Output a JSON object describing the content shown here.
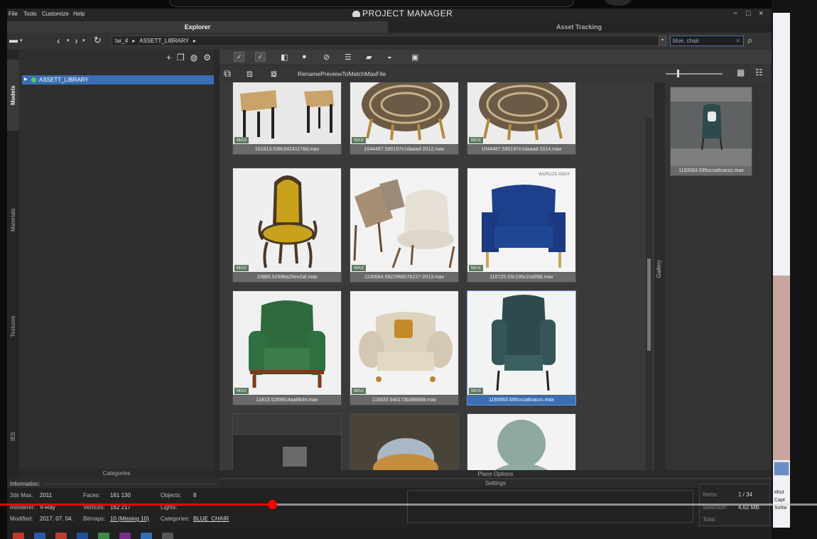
{
  "menu": {
    "file": "File",
    "tools": "Tools",
    "customize": "Customize",
    "help": "Help"
  },
  "app_title": "PROJECT MANAGER",
  "window_controls": {
    "minimize": "−",
    "maximize": "□",
    "close": "×"
  },
  "tabs": {
    "explorer": "Explorer",
    "asset_tracking": "Asset Tracking"
  },
  "breadcrumb": {
    "root": "tar_4",
    "sep": "▸",
    "folder": "ASSETT_LIBRARY",
    "tail": "▸"
  },
  "search": {
    "value": "blue, chair"
  },
  "left_tabs": [
    "Models",
    "Materials",
    "Textures",
    "IES"
  ],
  "tree": {
    "item": "ASSETT_LIBRARY"
  },
  "categories_footer": "Categories",
  "toolbar2": {
    "rename_label": "RenamePreviewToMatchMaxFile"
  },
  "thumbnails": [
    {
      "caption": "101813.538c54241176d.max",
      "badge": "MAX"
    },
    {
      "caption": "1044487.590197e1daaad-2012.max",
      "badge": "MAX"
    },
    {
      "caption": "1044487.590197e1daaad-2014.max",
      "badge": "MAX"
    },
    {
      "caption": "10885.52696a25ee2af.max",
      "badge": "MAX"
    },
    {
      "caption": "1100594.592296807b227-2013.max",
      "badge": "MAX"
    },
    {
      "caption": "110725.53c195c2cd398.max",
      "badge": "MAX",
      "watermark": "WORLDS AWAY"
    },
    {
      "caption": "11813.5269914aa8644.max",
      "badge": "MAX"
    },
    {
      "caption": "119333.540173b388889.max",
      "badge": "MAX"
    },
    {
      "caption": "1193563.595ccca8caccc.max",
      "badge": "MAX",
      "selected": true
    }
  ],
  "gallery": {
    "label": "Gallery",
    "caption": "1193563.595ccca8caccc.max"
  },
  "place_options": "Place Options",
  "settings": "Settings",
  "info": {
    "header": "Information:",
    "max_label": "3ds Max:",
    "max_value": "2011",
    "renderer_label": "Renderer:",
    "renderer_value": "V-Ray",
    "modified_label": "Modified:",
    "modified_value": "2017. 07. 04.",
    "faces_label": "Faces:",
    "faces_value": "161 130",
    "vertices_label": "Vertices:",
    "vertices_value": "162 217",
    "bitmaps_label": "Bitmaps:",
    "bitmaps_value": "10 (Missing 10)",
    "objects_label": "Objects:",
    "objects_value": "8",
    "lights_label": "Lights:",
    "categories_label": "Categories:",
    "categories_value": "BLUE_CHAIR",
    "items_label": "Items:",
    "items_value": "1 / 34",
    "selection_label": "Selection:",
    "selection_value": "4,62 MB",
    "total_label": "Total:"
  },
  "desktop_text": [
    "ebut",
    "Capt",
    "Softw"
  ],
  "video": {
    "progress": 0.334
  },
  "colors": {
    "accent_blue": "#3b6fb3",
    "status_green": "#4fd04f",
    "video_red": "#ff0000"
  }
}
